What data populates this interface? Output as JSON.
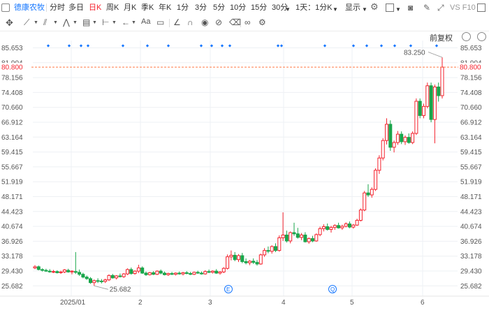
{
  "header": {
    "stock_name": "德康农牧",
    "periods": [
      "分时",
      "多日",
      "日K",
      "周K",
      "月K",
      "季K",
      "年K",
      "1分",
      "3分",
      "5分",
      "10分",
      "15分",
      "30分"
    ],
    "active_period": "日K",
    "period_select": "1天：1分K",
    "display_label": "显示",
    "right_label": "VS F10"
  },
  "adjust_label": "前复权",
  "chart_data": {
    "type": "candlestick",
    "x_tick_labels": [
      "2025/01",
      "2",
      "3",
      "4",
      "5",
      "6"
    ],
    "y_tick_labels": [
      "85.653",
      "81.904",
      "78.156",
      "74.408",
      "70.660",
      "66.912",
      "63.164",
      "59.415",
      "55.667",
      "51.919",
      "48.171",
      "44.423",
      "40.674",
      "36.926",
      "33.178",
      "29.430",
      "25.682"
    ],
    "ylim": [
      23.8,
      87.5
    ],
    "reference_price": "80.800",
    "max_label": "83.250",
    "min_label": "25.682",
    "event_markers": [
      "E",
      "Q"
    ],
    "colors": {
      "up": "#f5222d",
      "down": "#18a64b",
      "ref": "#ff7a45",
      "marker": "#1677ff"
    },
    "candles": [
      [
        30.2,
        30.9,
        29.9,
        30.5
      ],
      [
        30.5,
        30.8,
        29.6,
        29.8
      ],
      [
        29.8,
        30.1,
        29.3,
        29.6
      ],
      [
        29.6,
        30.0,
        29.2,
        29.4
      ],
      [
        29.4,
        29.9,
        29.0,
        29.2
      ],
      [
        29.2,
        29.7,
        28.9,
        29.3
      ],
      [
        29.3,
        29.6,
        28.8,
        29.0
      ],
      [
        29.0,
        29.5,
        28.7,
        29.2
      ],
      [
        29.2,
        29.9,
        28.9,
        29.7
      ],
      [
        29.6,
        30.0,
        29.0,
        29.2
      ],
      [
        29.2,
        29.6,
        28.6,
        29.4
      ],
      [
        29.3,
        34.2,
        28.7,
        29.1
      ],
      [
        29.1,
        29.8,
        28.2,
        28.6
      ],
      [
        28.6,
        29.0,
        27.6,
        27.9
      ],
      [
        27.9,
        28.3,
        27.2,
        27.5
      ],
      [
        27.5,
        27.9,
        26.2,
        26.5
      ],
      [
        26.5,
        27.3,
        25.7,
        27.0
      ],
      [
        27.0,
        27.6,
        26.4,
        26.9
      ],
      [
        26.9,
        27.4,
        26.3,
        26.8
      ],
      [
        26.8,
        27.5,
        26.4,
        27.2
      ],
      [
        27.2,
        28.6,
        26.9,
        28.3
      ],
      [
        28.3,
        28.7,
        27.5,
        27.7
      ],
      [
        27.7,
        28.4,
        27.3,
        28.2
      ],
      [
        28.2,
        28.8,
        27.8,
        28.0
      ],
      [
        28.0,
        28.9,
        27.7,
        28.7
      ],
      [
        28.7,
        30.1,
        28.4,
        29.8
      ],
      [
        29.8,
        30.3,
        28.5,
        28.8
      ],
      [
        28.8,
        29.6,
        28.5,
        29.4
      ],
      [
        29.4,
        31.0,
        28.9,
        30.2
      ],
      [
        30.2,
        30.6,
        28.7,
        28.9
      ],
      [
        28.9,
        29.3,
        28.2,
        28.5
      ],
      [
        28.5,
        29.2,
        28.3,
        29.0
      ],
      [
        29.0,
        29.4,
        28.4,
        28.6
      ],
      [
        28.6,
        29.6,
        28.4,
        29.4
      ],
      [
        29.4,
        29.8,
        28.6,
        28.9
      ],
      [
        28.9,
        29.3,
        28.3,
        28.5
      ],
      [
        28.5,
        29.0,
        28.2,
        28.8
      ],
      [
        28.8,
        29.2,
        28.4,
        28.6
      ],
      [
        28.6,
        29.1,
        28.3,
        28.9
      ],
      [
        28.9,
        29.3,
        28.5,
        28.7
      ],
      [
        28.7,
        29.2,
        28.3,
        29.0
      ],
      [
        29.0,
        29.4,
        28.6,
        28.8
      ],
      [
        28.8,
        29.2,
        28.4,
        28.6
      ],
      [
        28.6,
        29.3,
        28.4,
        29.1
      ],
      [
        29.1,
        29.5,
        28.7,
        28.9
      ],
      [
        28.9,
        29.3,
        28.5,
        28.7
      ],
      [
        28.7,
        29.6,
        28.5,
        29.3
      ],
      [
        29.3,
        29.8,
        28.9,
        29.1
      ],
      [
        29.1,
        29.6,
        28.8,
        29.4
      ],
      [
        29.4,
        29.9,
        28.7,
        28.9
      ],
      [
        28.9,
        29.4,
        28.5,
        29.2
      ],
      [
        29.2,
        30.4,
        28.9,
        30.1
      ],
      [
        30.1,
        33.6,
        29.8,
        33.0
      ],
      [
        33.0,
        34.6,
        32.1,
        33.4
      ],
      [
        33.4,
        34.2,
        31.9,
        32.3
      ],
      [
        32.3,
        33.7,
        31.7,
        33.3
      ],
      [
        33.3,
        34.0,
        31.4,
        31.8
      ],
      [
        31.8,
        32.6,
        31.1,
        31.5
      ],
      [
        31.5,
        32.2,
        30.9,
        31.9
      ],
      [
        31.9,
        32.6,
        31.2,
        31.6
      ],
      [
        31.6,
        32.2,
        30.8,
        31.2
      ],
      [
        31.2,
        33.8,
        31.0,
        33.5
      ],
      [
        33.5,
        35.2,
        33.0,
        34.6
      ],
      [
        34.6,
        35.6,
        33.9,
        34.4
      ],
      [
        34.4,
        35.9,
        33.8,
        35.6
      ],
      [
        35.6,
        36.4,
        34.2,
        34.6
      ],
      [
        34.6,
        38.4,
        34.3,
        37.8
      ],
      [
        37.8,
        44.2,
        37.0,
        38.5
      ],
      [
        38.5,
        39.6,
        36.6,
        37.0
      ],
      [
        37.0,
        39.4,
        36.4,
        39.1
      ],
      [
        39.1,
        41.6,
        38.3,
        38.8
      ],
      [
        38.8,
        40.3,
        37.6,
        37.9
      ],
      [
        37.9,
        39.0,
        37.2,
        38.5
      ],
      [
        38.5,
        39.2,
        36.6,
        36.8
      ],
      [
        36.8,
        37.9,
        36.3,
        37.6
      ],
      [
        37.6,
        38.3,
        36.7,
        37.0
      ],
      [
        37.0,
        38.9,
        36.8,
        38.6
      ],
      [
        38.6,
        40.6,
        38.2,
        40.1
      ],
      [
        40.1,
        41.2,
        39.4,
        40.6
      ],
      [
        40.6,
        41.4,
        39.6,
        39.9
      ],
      [
        39.9,
        40.8,
        39.1,
        40.4
      ],
      [
        40.4,
        41.2,
        39.8,
        40.9
      ],
      [
        40.9,
        41.6,
        40.1,
        40.3
      ],
      [
        40.3,
        41.1,
        39.8,
        40.7
      ],
      [
        40.7,
        41.7,
        40.4,
        41.3
      ],
      [
        41.3,
        41.9,
        40.2,
        40.5
      ],
      [
        40.5,
        41.3,
        40.1,
        41.0
      ],
      [
        41.0,
        42.6,
        40.8,
        42.2
      ],
      [
        42.2,
        45.2,
        41.9,
        44.8
      ],
      [
        44.8,
        49.6,
        44.5,
        49.1
      ],
      [
        49.1,
        51.3,
        48.1,
        48.6
      ],
      [
        48.6,
        50.5,
        47.9,
        50.0
      ],
      [
        50.0,
        55.3,
        49.6,
        54.8
      ],
      [
        54.8,
        58.6,
        53.9,
        57.9
      ],
      [
        57.9,
        62.9,
        57.3,
        62.3
      ],
      [
        62.3,
        67.9,
        61.3,
        66.4
      ],
      [
        66.4,
        67.4,
        59.7,
        60.6
      ],
      [
        60.6,
        62.3,
        59.3,
        61.8
      ],
      [
        61.8,
        64.7,
        61.2,
        63.9
      ],
      [
        63.9,
        64.6,
        61.4,
        62.0
      ],
      [
        62.0,
        63.6,
        61.2,
        63.1
      ],
      [
        63.1,
        64.1,
        61.5,
        61.8
      ],
      [
        61.8,
        64.6,
        61.4,
        64.1
      ],
      [
        64.1,
        72.9,
        63.7,
        72.2
      ],
      [
        72.2,
        72.9,
        67.9,
        68.6
      ],
      [
        68.6,
        71.6,
        67.9,
        70.9
      ],
      [
        70.9,
        76.9,
        70.4,
        76.1
      ],
      [
        76.1,
        76.9,
        66.9,
        67.6
      ],
      [
        67.6,
        76.4,
        61.6,
        75.8
      ],
      [
        75.8,
        76.9,
        72.1,
        73.6
      ],
      [
        73.6,
        83.25,
        72.9,
        80.8
      ]
    ]
  }
}
